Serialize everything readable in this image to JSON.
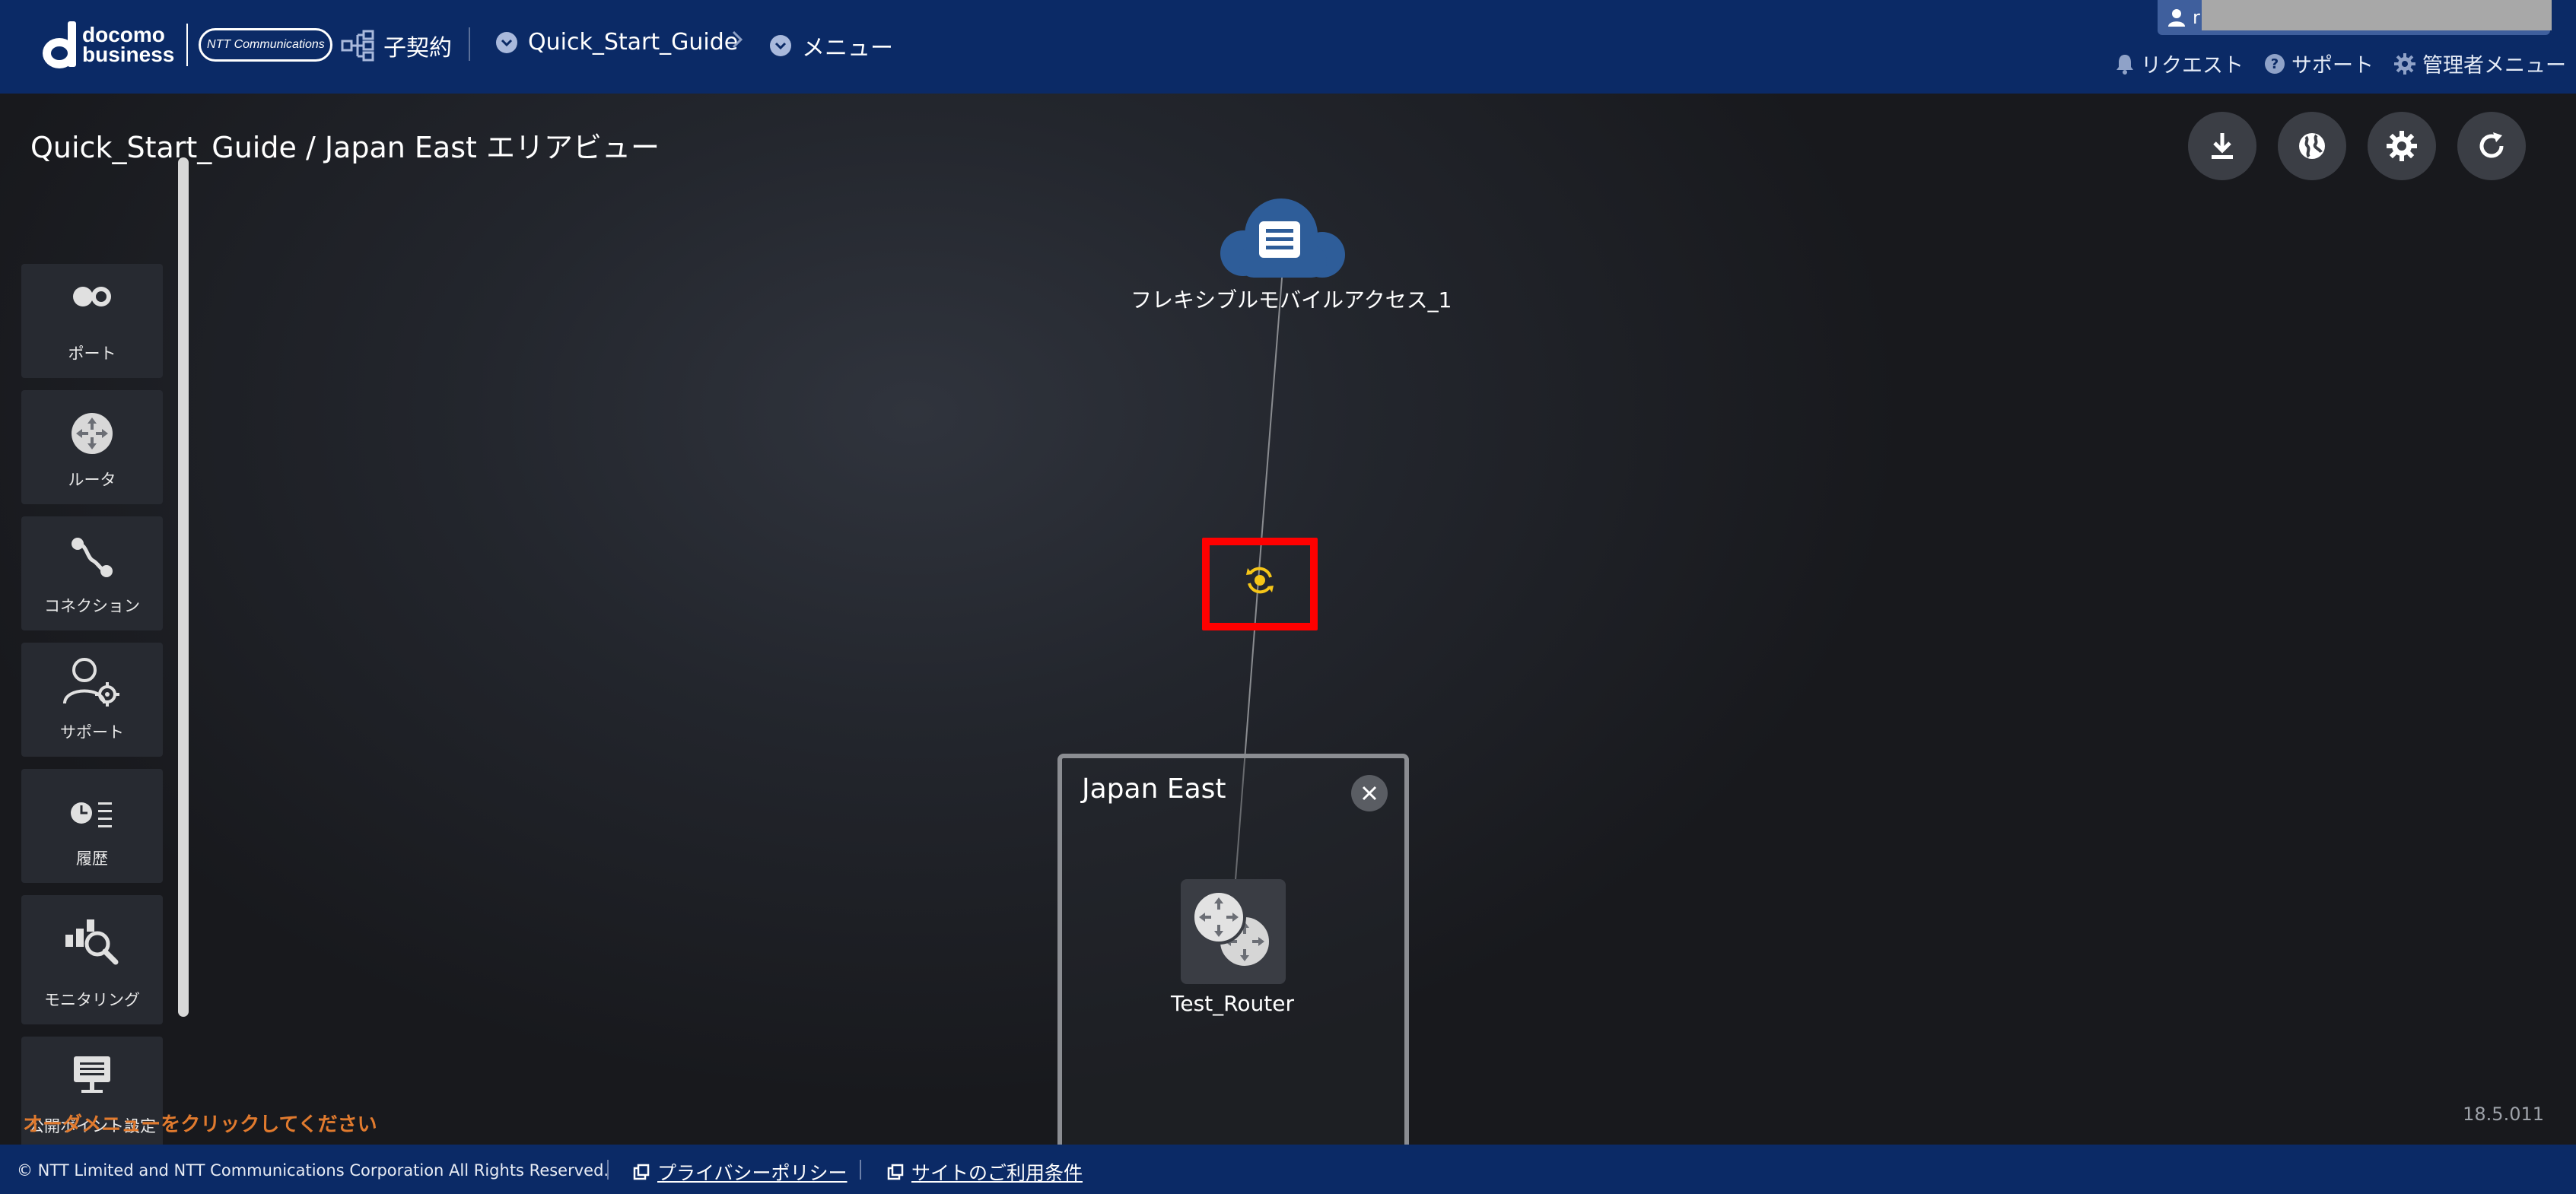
{
  "header": {
    "logo_line1": "docomo",
    "logo_line2": "business",
    "ntt_logo_text": "NTT Communications",
    "contract_label": "子契約",
    "breadcrumb": [
      "Quick_Start_Guide",
      "メニュー"
    ],
    "user_initial": "r",
    "links": {
      "request": "リクエスト",
      "support": "サポート",
      "admin": "管理者メニュー"
    }
  },
  "main": {
    "title": "Quick_Start_Guide / Japan East エリアビュー",
    "sidebar": [
      {
        "label": "ポート",
        "icon": "port-icon"
      },
      {
        "label": "ルータ",
        "icon": "router-icon"
      },
      {
        "label": "コネクション",
        "icon": "connection-icon"
      },
      {
        "label": "サポート",
        "icon": "support-user-gear-icon"
      },
      {
        "label": "履歴",
        "icon": "history-icon"
      },
      {
        "label": "モニタリング",
        "icon": "monitoring-icon"
      },
      {
        "label": "公開ポイント設定",
        "icon": "public-point-icon"
      }
    ],
    "tools": [
      "download-icon",
      "globe-icon",
      "settings-icon",
      "refresh-icon"
    ],
    "cloud_node_label": "フレキシブルモバイルアクセス_1",
    "area": {
      "title": "Japan East",
      "router_label": "Test_Router"
    },
    "hint": "オーダメニューをクリックしてください",
    "version": "18.5.011"
  },
  "footer": {
    "copyright": "© NTT Limited and NTT Communications Corporation All Rights Reserved.",
    "privacy": "プライバシーポリシー",
    "terms": "サイトのご利用条件"
  },
  "colors": {
    "header_bg": "#0b2a66",
    "highlight": "#ff0000",
    "status_icon": "#f5c518",
    "hint_text": "#e07a2e",
    "cloud": "#2e5d99"
  }
}
